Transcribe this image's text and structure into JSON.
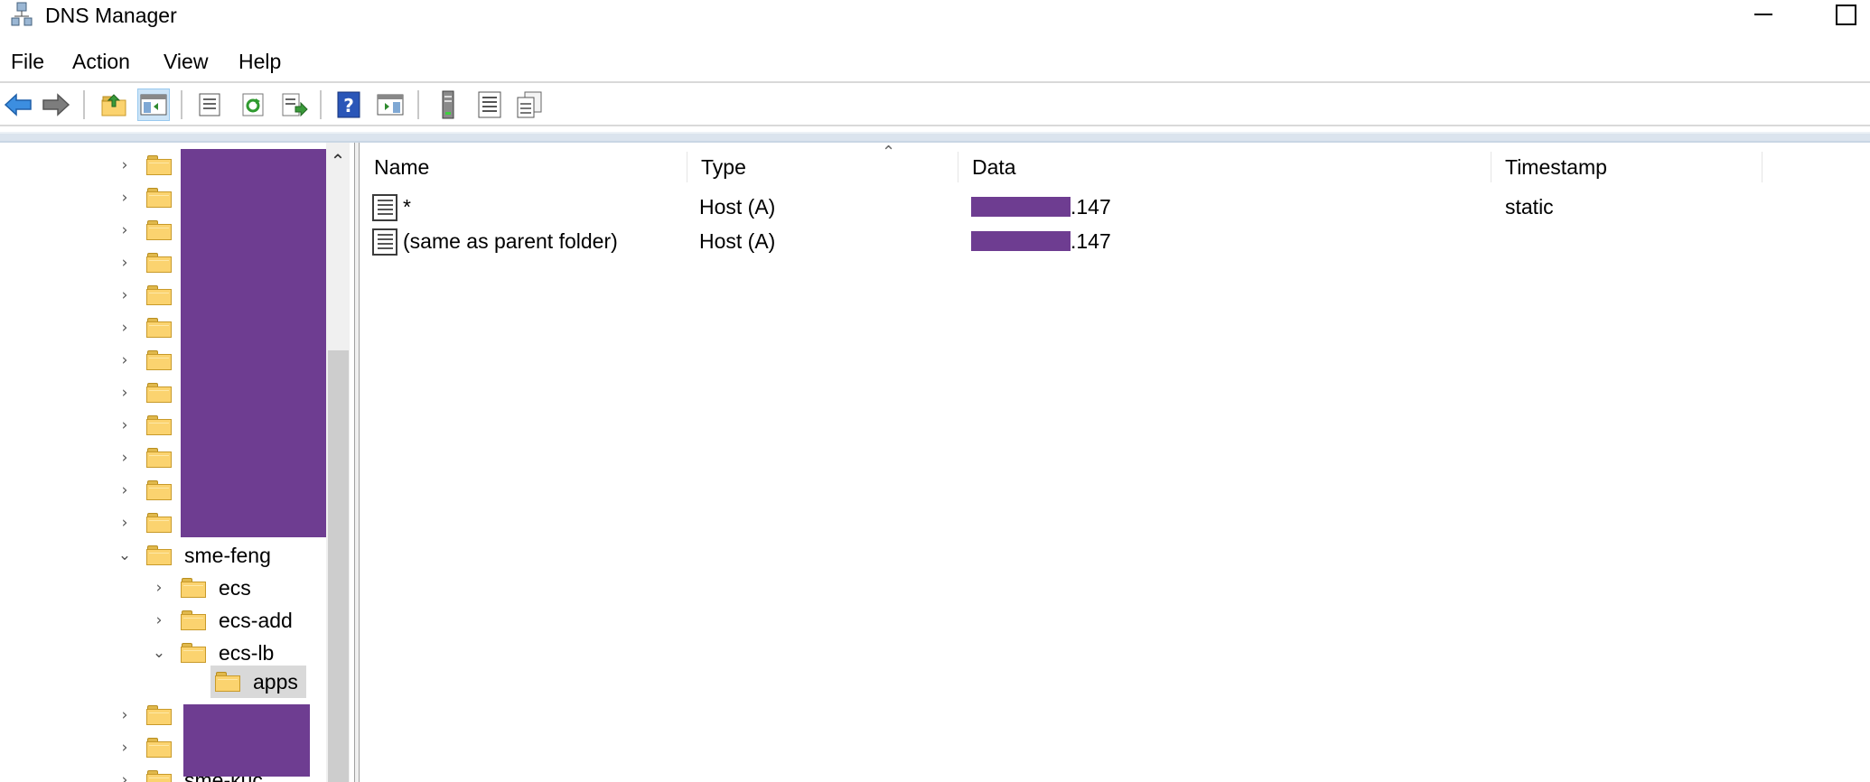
{
  "window": {
    "title": "DNS Manager",
    "app_icon": "dns-manager-icon"
  },
  "menu": {
    "file": "File",
    "action": "Action",
    "view": "View",
    "help": "Help"
  },
  "toolbar": {
    "icons": [
      "back-arrow-icon",
      "forward-arrow-icon",
      "up-folder-icon",
      "show-hide-console-tree-icon",
      "properties-icon",
      "refresh-icon",
      "export-list-icon",
      "help-icon",
      "show-hide-action-pane-icon",
      "server-icon",
      "list-view-icon",
      "copy-records-icon"
    ]
  },
  "tree": {
    "collapsed_count": 12,
    "expanded_zone": "sme-feng",
    "children": [
      "ecs",
      "ecs-add",
      "ecs-lb"
    ],
    "selected": "apps",
    "partial_bottom_label": "sme-kuc"
  },
  "list": {
    "columns": {
      "name": "Name",
      "type": "Type",
      "data": "Data",
      "timestamp": "Timestamp"
    },
    "rows": [
      {
        "name": "*",
        "type": "Host (A)",
        "data_suffix": ".147",
        "timestamp": "static"
      },
      {
        "name": "(same as parent folder)",
        "type": "Host (A)",
        "data_suffix": ".147",
        "timestamp": ""
      }
    ]
  },
  "colors": {
    "redaction": "#6e3d91",
    "folder": "#fbd36f",
    "selection": "#d9d9d9",
    "toolbar_band": "#dbe4ee"
  }
}
